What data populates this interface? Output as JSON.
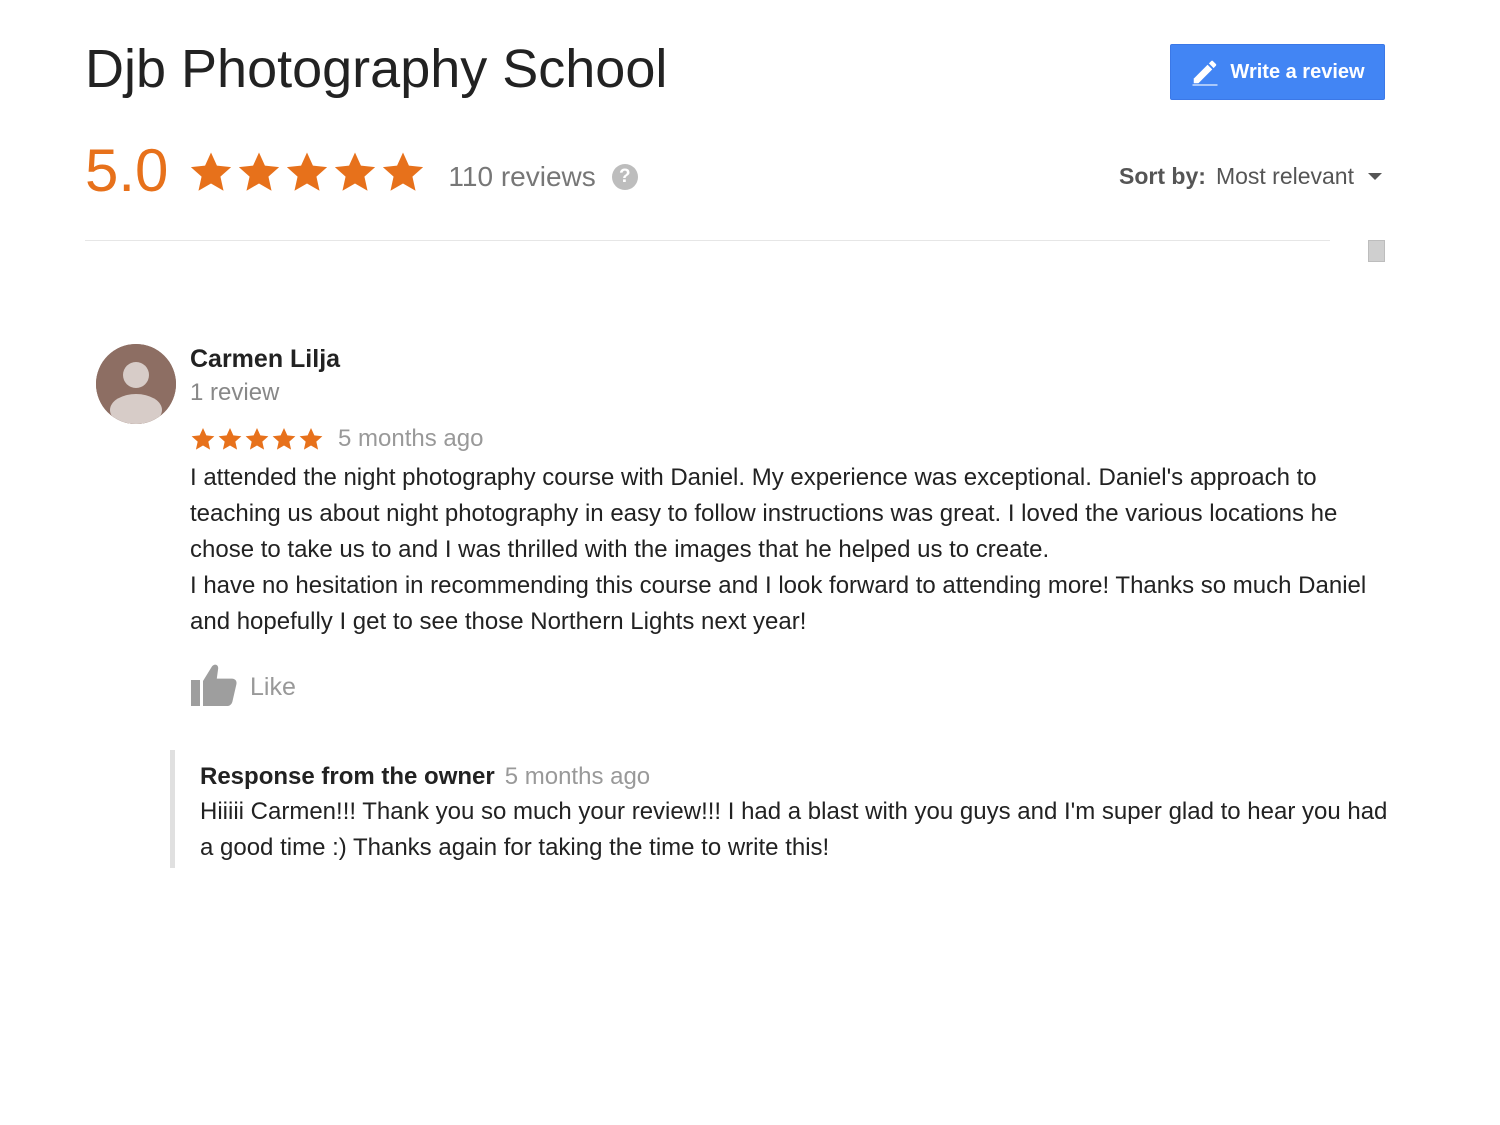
{
  "header": {
    "business_name": "Djb Photography School",
    "write_review_label": "Write a review"
  },
  "summary": {
    "rating": "5.0",
    "stars": 5,
    "review_count_label": "110 reviews",
    "help_glyph": "?"
  },
  "sort": {
    "label": "Sort by:",
    "value": "Most relevant"
  },
  "colors": {
    "star": "#e7711b",
    "button": "#4285f4"
  },
  "review": {
    "author": "Carmen Lilja",
    "author_review_count": "1 review",
    "stars": 5,
    "date": "5 months ago",
    "text": "I attended the night photography course with Daniel. My experience was exceptional. Daniel's approach to teaching us about night photography in easy to follow instructions was great. I loved the various locations he chose to take us to and I was thrilled with the images that he helped us to create.\nI have no hesitation in recommending this course and I look forward to attending more! Thanks so much Daniel and hopefully I get to see those Northern Lights next year!",
    "like_label": "Like"
  },
  "owner_response": {
    "title": "Response from the owner",
    "date": "5 months ago",
    "text": "Hiiiii Carmen!!! Thank you so much your review!!! I had a blast with you guys and I'm super glad to hear you had a good time :) Thanks again for taking the time to write this!"
  }
}
